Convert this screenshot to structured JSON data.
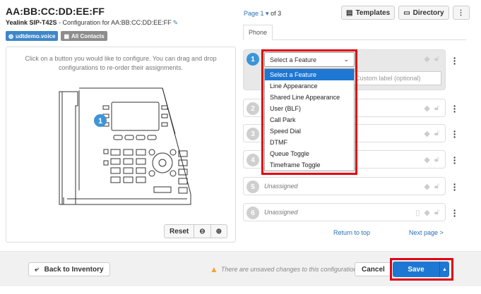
{
  "header": {
    "mac": "AA:BB:CC:DD:EE:FF",
    "model": "Yealink SIP-T42S",
    "config_text": " - Configuration for AA:BB:CC:DD:EE:FF",
    "tags": [
      "udtdemo.voice",
      "All Contacts"
    ]
  },
  "left": {
    "instructions_line1": "Click on a button you would like to configure. You can drag and drop",
    "instructions_line2": "configurations to re-order their assignments.",
    "marker": "1",
    "reset_label": "Reset"
  },
  "pager": {
    "prefix": "Page ",
    "current": "1",
    "suffix": " of 3",
    "templates_label": "Templates",
    "directory_label": "Directory"
  },
  "tab": {
    "label": "Phone"
  },
  "feature_select": {
    "value": "Select a Feature",
    "custom_placeholder": "Custom label (optional)",
    "options": [
      "Select a Feature",
      "Line Appearance",
      "Shared Line Appearance",
      "User (BLF)",
      "Call Park",
      "Speed Dial",
      "DTMF",
      "Queue Toggle",
      "Timeframe Toggle"
    ]
  },
  "slots": [
    {
      "num": "1",
      "label": ""
    },
    {
      "num": "2",
      "label": ""
    },
    {
      "num": "3",
      "label": ""
    },
    {
      "num": "4",
      "label": ""
    },
    {
      "num": "5",
      "label": "Unassigned"
    },
    {
      "num": "6",
      "label": "Unassigned"
    }
  ],
  "nav": {
    "return_top": "Return to top",
    "next_page": "Next page >"
  },
  "footer": {
    "back_label": "Back to Inventory",
    "warning": "There are unsaved changes to this configuration",
    "cancel_label": "Cancel",
    "save_label": "Save"
  },
  "colors": {
    "accent": "#1e77d3",
    "highlight": "#e00012",
    "warning": "#f0a530"
  }
}
